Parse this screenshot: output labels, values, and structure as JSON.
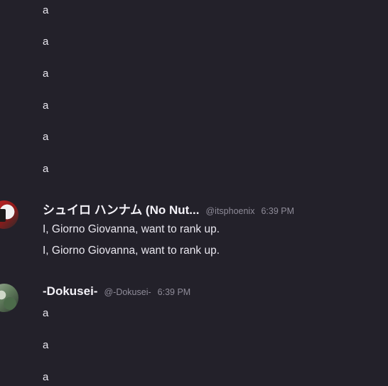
{
  "top_lines": [
    "a",
    "a",
    "a",
    "a",
    "a",
    "a"
  ],
  "messages": [
    {
      "username": "シュイロ ハンナム (No Nut...",
      "handle": "@itsphoenix",
      "time": "6:39 PM",
      "lines": [
        "I, Giorno Giovanna, want to rank up.",
        "I, Giorno Giovanna, want to rank up."
      ]
    },
    {
      "username": "-Dokusei-",
      "handle": "@-Dokusei-",
      "time": "6:39 PM",
      "lines": [
        "a",
        "a",
        "a"
      ]
    }
  ]
}
